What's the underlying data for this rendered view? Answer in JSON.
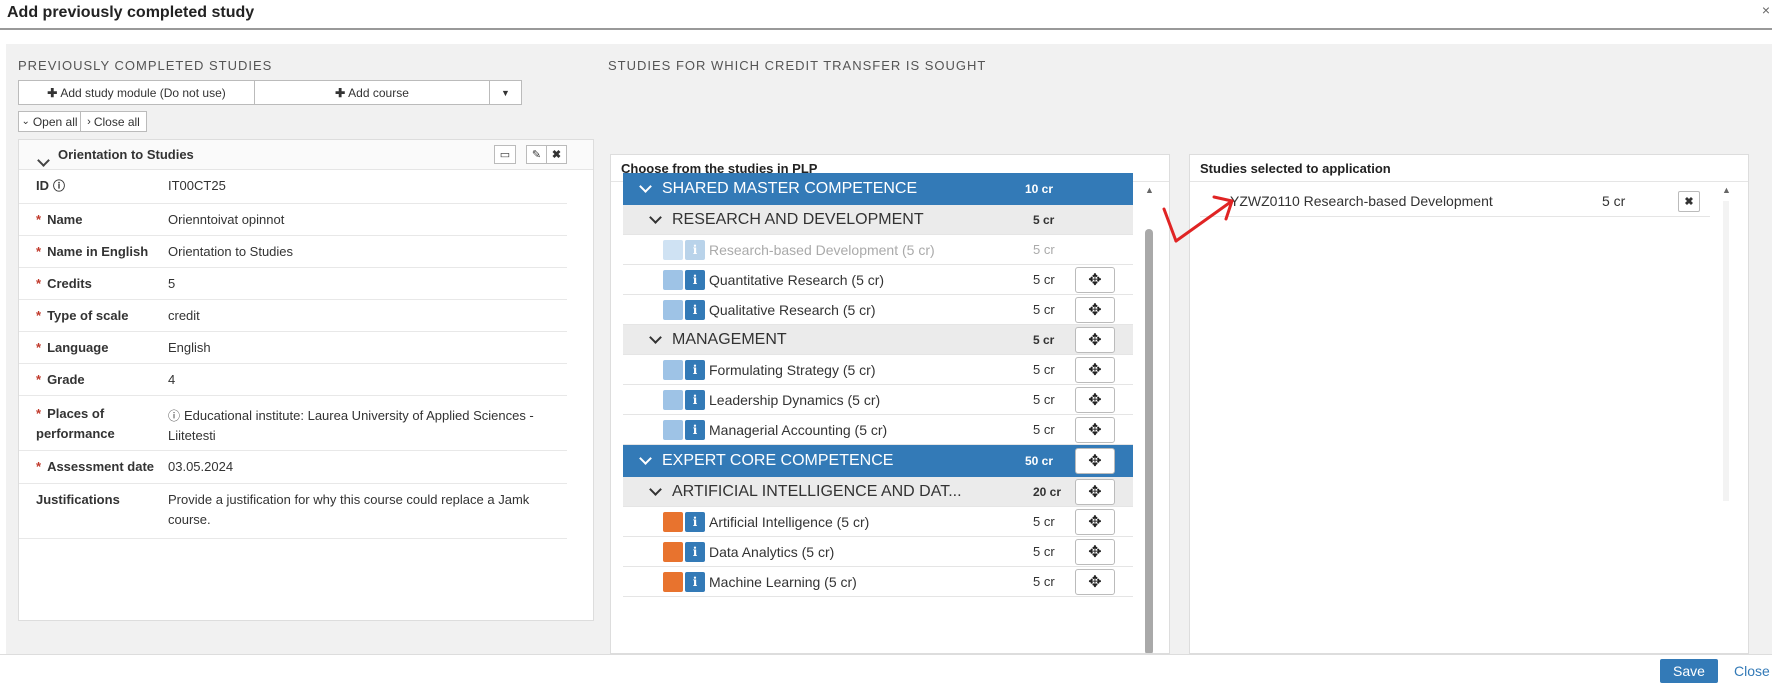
{
  "dialog": {
    "title": "Add previously completed study",
    "close_glyph": "×",
    "save_label": "Save",
    "close_label": "Close"
  },
  "left": {
    "heading": "PREVIOUSLY COMPLETED STUDIES",
    "add_module_label": "Add study module (Do not use)",
    "add_course_label": "Add course",
    "open_all_label": "Open all",
    "close_all_label": "Close all",
    "card_title": "Orientation to Studies",
    "fields": [
      {
        "label": "ID",
        "value": "IT00CT25",
        "required": false,
        "info": true
      },
      {
        "label": "Name",
        "value": "Orienntoivat opinnot",
        "required": true
      },
      {
        "label": "Name in English",
        "value": "Orientation to Studies",
        "required": true
      },
      {
        "label": "Credits",
        "value": "5",
        "required": true
      },
      {
        "label": "Type of scale",
        "value": "credit",
        "required": true
      },
      {
        "label": "Language",
        "value": "English",
        "required": true
      },
      {
        "label": "Grade",
        "value": "4",
        "required": true
      },
      {
        "label": "Places of performance",
        "value": "Educational institute: Laurea University of Applied Sciences - Liitetesti",
        "required": true,
        "value_info": true
      },
      {
        "label": "Assessment date",
        "value": "03.05.2024",
        "required": true
      },
      {
        "label": "Justifications",
        "value": "Provide a justification for why this course could replace a Jamk course.",
        "required": false
      }
    ]
  },
  "middle": {
    "heading": "STUDIES FOR WHICH CREDIT TRANSFER IS SOUGHT",
    "panel_title": "Choose from the studies in PLP",
    "rows": [
      {
        "kind": "blue",
        "label": "SHARED MASTER COMPETENCE",
        "credits": "10 cr",
        "move": false
      },
      {
        "kind": "group",
        "label": "RESEARCH AND DEVELOPMENT",
        "credits": "5 cr",
        "move": false
      },
      {
        "kind": "course",
        "label": "Research-based Development (5 cr)",
        "credits": "5 cr",
        "move": false,
        "disabled": true,
        "color": "#cfe2f3"
      },
      {
        "kind": "course",
        "label": "Quantitative Research (5 cr)",
        "credits": "5 cr",
        "move": true,
        "color": "#9ec3e6"
      },
      {
        "kind": "course",
        "label": "Qualitative Research (5 cr)",
        "credits": "5 cr",
        "move": true,
        "color": "#9ec3e6"
      },
      {
        "kind": "group",
        "label": "MANAGEMENT",
        "credits": "5 cr",
        "move": true
      },
      {
        "kind": "course",
        "label": "Formulating Strategy (5 cr)",
        "credits": "5 cr",
        "move": true,
        "color": "#9ec3e6"
      },
      {
        "kind": "course",
        "label": "Leadership Dynamics (5 cr)",
        "credits": "5 cr",
        "move": true,
        "color": "#9ec3e6"
      },
      {
        "kind": "course",
        "label": "Managerial Accounting (5 cr)",
        "credits": "5 cr",
        "move": true,
        "color": "#9ec3e6"
      },
      {
        "kind": "blue",
        "label": "EXPERT CORE COMPETENCE",
        "credits": "50 cr",
        "move": true
      },
      {
        "kind": "group",
        "label": "ARTIFICIAL INTELLIGENCE AND DAT...",
        "credits": "20 cr",
        "move": true
      },
      {
        "kind": "course",
        "label": "Artificial Intelligence (5 cr)",
        "credits": "5 cr",
        "move": true,
        "color": "#e8732e"
      },
      {
        "kind": "course",
        "label": "Data Analytics (5 cr)",
        "credits": "5 cr",
        "move": true,
        "color": "#e8732e"
      },
      {
        "kind": "course",
        "label": "Machine Learning (5 cr)",
        "credits": "5 cr",
        "move": true,
        "color": "#e8732e"
      }
    ]
  },
  "right": {
    "panel_title": "Studies selected to application",
    "selected": [
      {
        "label": "YZWZ0110 Research-based Development",
        "credits": "5 cr"
      }
    ]
  },
  "colors": {
    "accent": "#337ab7",
    "required": "#c0392b",
    "annotation_arrow": "#e02424"
  }
}
